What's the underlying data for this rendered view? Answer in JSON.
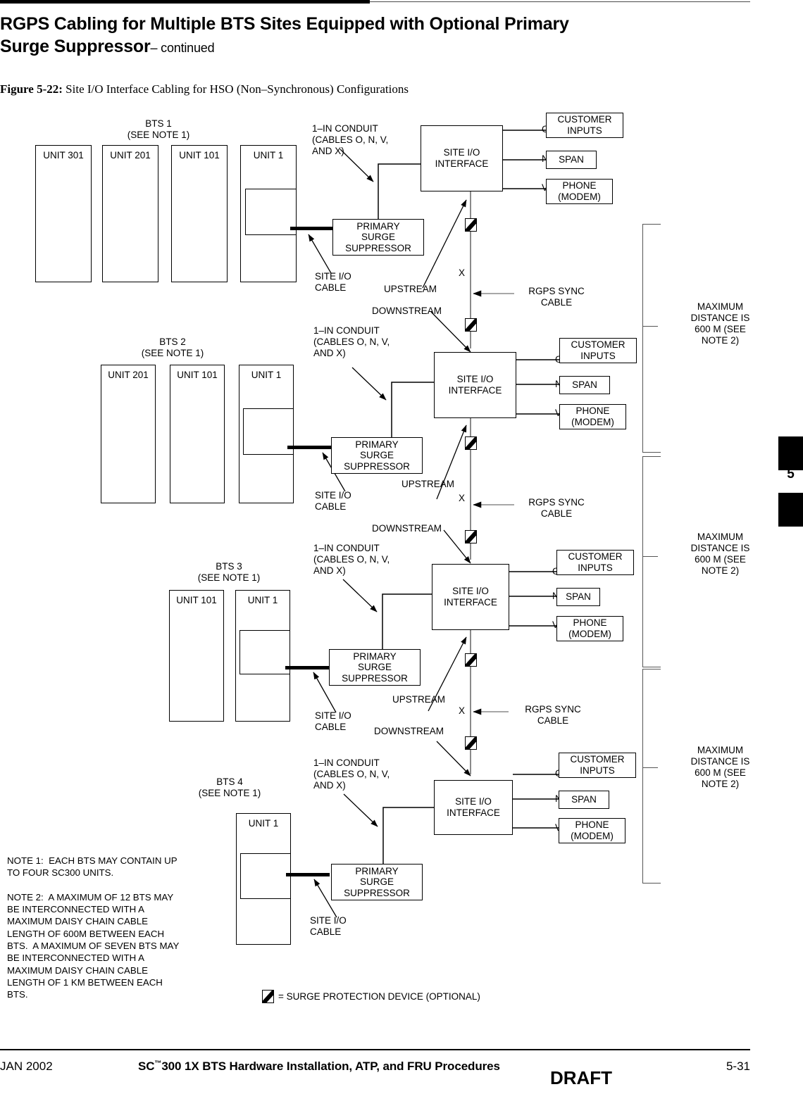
{
  "header": {
    "chapter_title_line1": "RGPS Cabling for Multiple BTS Sites Equipped with Optional Primary",
    "chapter_title_line2": "Surge Suppressor",
    "continued": "– continued"
  },
  "figure": {
    "label": "Figure 5-22:",
    "caption": " Site I/O Interface Cabling for HSO (Non–Synchronous) Configurations"
  },
  "diagram": {
    "site_io_interface": "SITE I/O\nINTERFACE",
    "primary_surge_suppressor": "PRIMARY\nSURGE\nSUPPRESSOR",
    "site_io_cable": "SITE I/O\nCABLE",
    "conduit_label": "1–IN CONDUIT\n(CABLES O, N, V,\nAND X)",
    "upstream": "UPSTREAM",
    "downstream": "DOWNSTREAM",
    "rgps_sync_cable": "RGPS SYNC\nCABLE",
    "x_label": "X",
    "port_o": "O",
    "port_n": "N",
    "port_v": "V",
    "customer_inputs": "CUSTOMER\nINPUTS",
    "span": "SPAN",
    "phone_modem": "PHONE\n(MODEM)",
    "max_distance": "MAXIMUM\nDISTANCE IS\n600 M (SEE\nNOTE 2)",
    "bts_sites": [
      {
        "title": "BTS 1",
        "note": "(SEE NOTE 1)",
        "units": [
          "UNIT\n301",
          "UNIT\n201",
          "UNIT\n101",
          "UNIT 1"
        ]
      },
      {
        "title": "BTS 2",
        "note": "(SEE NOTE 1)",
        "units": [
          "UNIT\n201",
          "UNIT\n101",
          "UNIT 1"
        ]
      },
      {
        "title": "BTS 3",
        "note": "(SEE NOTE 1)",
        "units": [
          "UNIT\n101",
          "UNIT 1"
        ]
      },
      {
        "title": "BTS 4",
        "note": "(SEE NOTE 1)",
        "units": [
          "UNIT 1"
        ]
      }
    ]
  },
  "notes": {
    "text": "NOTE 1:  EACH BTS MAY CONTAIN UP\nTO FOUR SC300 UNITS.\n\nNOTE 2:  A MAXIMUM OF 12 BTS MAY\nBE INTERCONNECTED WITH A\nMAXIMUM DAISY CHAIN CABLE\nLENGTH OF 600M BETWEEN EACH\nBTS.  A MAXIMUM OF SEVEN BTS MAY\nBE INTERCONNECTED WITH A\nMAXIMUM DAISY CHAIN CABLE\nLENGTH OF 1 KM BETWEEN EACH\nBTS."
  },
  "legend": {
    "text": "= SURGE PROTECTION DEVICE (OPTIONAL)"
  },
  "margin_tab": {
    "number": "5"
  },
  "footer": {
    "date": "JAN 2002",
    "title_pre": "SC",
    "title_tm": "™",
    "title_post": "300 1X BTS Hardware Installation, ATP, and FRU Procedures",
    "page": "5-31",
    "draft": "DRAFT"
  }
}
